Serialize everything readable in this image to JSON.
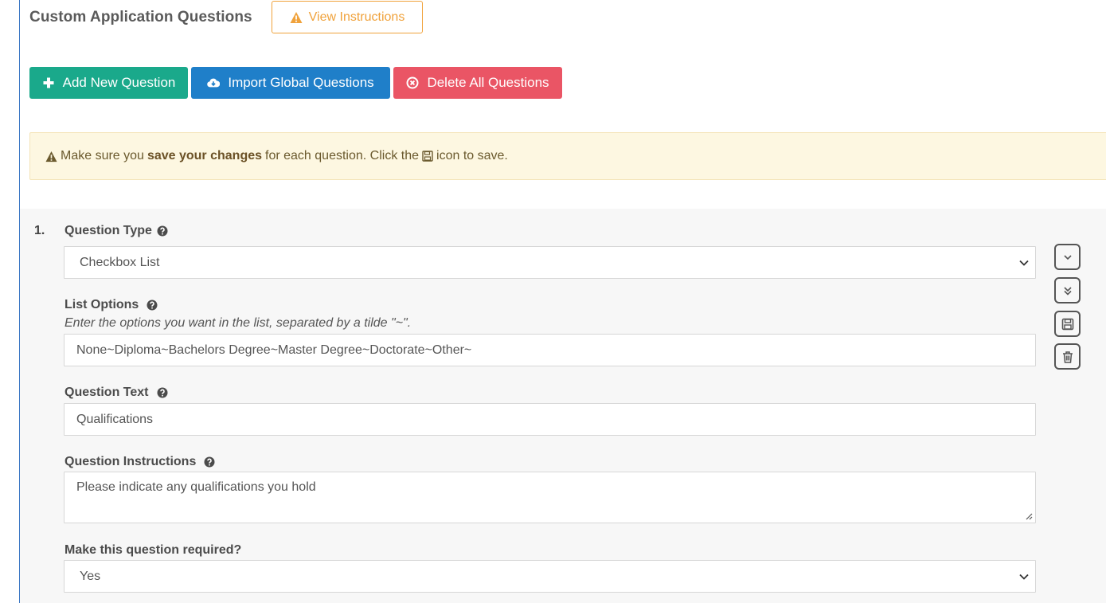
{
  "header": {
    "title": "Custom Application Questions",
    "view_instructions_label": "View Instructions"
  },
  "toolbar": {
    "add_label": "Add New Question",
    "import_label": "Import Global Questions",
    "delete_label": "Delete All Questions"
  },
  "alert": {
    "prefix": "Make sure you",
    "bold": "save your changes",
    "middle": "for each question. Click the",
    "suffix": "icon to save."
  },
  "question": {
    "number": "1.",
    "type_label": "Question Type",
    "type_value": "Checkbox List",
    "list_options_label": "List Options",
    "list_options_hint": "Enter the options you want in the list, separated by a tilde \"~\".",
    "list_options_value": "None~Diploma~Bachelors Degree~Master Degree~Doctorate~Other~",
    "text_label": "Question Text",
    "text_value": "Qualifications",
    "instructions_label": "Question Instructions",
    "instructions_value": "Please indicate any qualifications you hold",
    "required_label": "Make this question required?",
    "required_value": "Yes"
  },
  "icons": {
    "warning": "warning-triangle-icon",
    "add": "plus-icon",
    "import": "cloud-download-icon",
    "delete": "times-circle-icon",
    "help": "question-circle-icon",
    "save": "floppy-disk-icon",
    "chevron": "chevron-down-icon",
    "double_chevron": "double-chevron-down-icon",
    "trash": "trash-icon"
  },
  "colors": {
    "add": "#1aa98b",
    "import": "#1f7fc9",
    "delete": "#ea5565",
    "instructions": "#f0a23b",
    "alert_bg": "#fdf7e1"
  }
}
